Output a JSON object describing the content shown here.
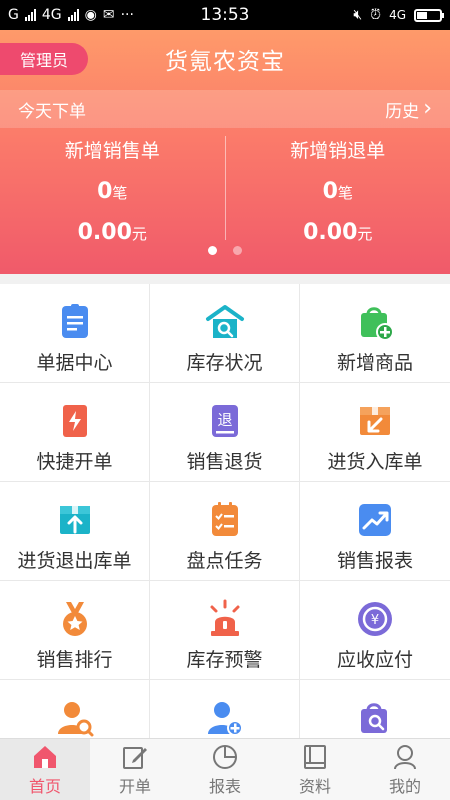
{
  "status_bar": {
    "left_text": "G",
    "network": "4G",
    "more": "···",
    "time": "13:53",
    "right_network": "4G"
  },
  "header": {
    "admin_label": "管理员",
    "title": "货氪农资宝"
  },
  "today": {
    "label": "今天下单",
    "history_label": "历史",
    "history_chevron": "›"
  },
  "cards": [
    {
      "title": "新增销售单",
      "count": "0",
      "count_unit": "笔",
      "amount": "0.00",
      "amount_unit": "元"
    },
    {
      "title": "新增销退单",
      "count": "0",
      "count_unit": "笔",
      "amount": "0.00",
      "amount_unit": "元"
    }
  ],
  "grid": [
    {
      "label": "单据中心",
      "icon": "document-icon"
    },
    {
      "label": "库存状况",
      "icon": "warehouse-icon"
    },
    {
      "label": "新增商品",
      "icon": "bag-add-icon"
    },
    {
      "label": "快捷开单",
      "icon": "quick-order-icon"
    },
    {
      "label": "销售退货",
      "icon": "return-icon",
      "glyph": "退"
    },
    {
      "label": "进货入库单",
      "icon": "box-in-icon"
    },
    {
      "label": "进货退出库单",
      "icon": "box-out-icon"
    },
    {
      "label": "盘点任务",
      "icon": "checklist-icon"
    },
    {
      "label": "销售报表",
      "icon": "trend-chart-icon"
    },
    {
      "label": "销售排行",
      "icon": "medal-icon"
    },
    {
      "label": "库存预警",
      "icon": "alarm-light-icon"
    },
    {
      "label": "应收应付",
      "icon": "yen-circle-icon",
      "glyph": "¥"
    },
    {
      "label": "",
      "icon": "user-search-icon"
    },
    {
      "label": "",
      "icon": "user-add-icon"
    },
    {
      "label": "",
      "icon": "bag-search-icon"
    }
  ],
  "tabs": [
    {
      "label": "首页",
      "icon": "home-icon",
      "active": true
    },
    {
      "label": "开单",
      "icon": "edit-icon",
      "active": false
    },
    {
      "label": "报表",
      "icon": "pie-chart-icon",
      "active": false
    },
    {
      "label": "资料",
      "icon": "book-icon",
      "active": false
    },
    {
      "label": "我的",
      "icon": "profile-icon",
      "active": false
    }
  ],
  "colors": {
    "accent": "#f0566d",
    "header_top": "#fe9a6a",
    "header_bottom": "#f05a6a",
    "admin_badge": "#ee4a6e",
    "blue": "#4a8cf0",
    "teal": "#1bb3c8",
    "green": "#3fc05a",
    "orange": "#f28a3a",
    "red_orange": "#f0624a",
    "purple": "#7b6ad8"
  }
}
